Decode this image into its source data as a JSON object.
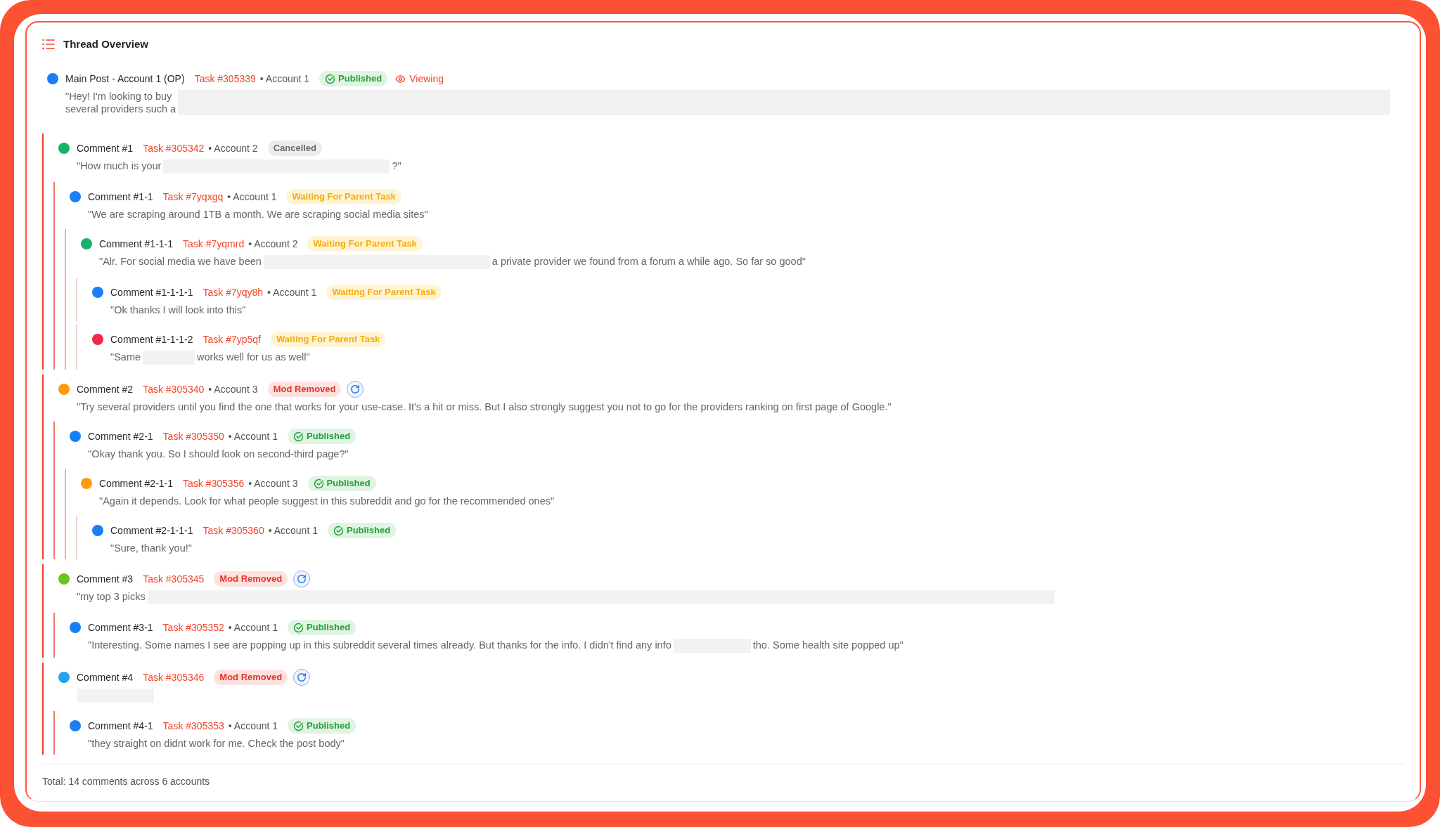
{
  "panel": {
    "title": "Thread Overview"
  },
  "post": {
    "title": "Main Post - Account 1 (OP)",
    "color": "#1a7ff5",
    "task": "Task #305339",
    "account": "• Account 1",
    "status": {
      "kind": "published",
      "label": "Published"
    },
    "refresh": false,
    "viewing": "Viewing",
    "body": [
      {
        "kind": "lines",
        "lines": [
          "\"Hey! I'm looking to buy",
          "several providers such a"
        ]
      },
      {
        "kind": "redacted-fill"
      }
    ]
  },
  "comments": [
    {
      "title": "Comment #1",
      "color": "#17b26a",
      "task": "Task #305342",
      "account": "• Account 2",
      "status": {
        "kind": "cancelled",
        "label": "Cancelled"
      },
      "refresh": false,
      "body": [
        {
          "kind": "text",
          "text": "\"How much is your"
        },
        {
          "kind": "redacted-medium"
        },
        {
          "kind": "text",
          "text": "?\""
        }
      ],
      "children": [
        {
          "title": "Comment #1-1",
          "color": "#1a7ff5",
          "task": "Task #7yqxgq",
          "account": "• Account 1",
          "status": {
            "kind": "waiting",
            "label": "Waiting For Parent Task"
          },
          "refresh": false,
          "body": [
            {
              "kind": "text",
              "text": "\"We are scraping around 1TB a month. We are scraping social media sites\""
            }
          ],
          "children": [
            {
              "title": "Comment #1-1-1",
              "color": "#17b26a",
              "task": "Task #7yqmrd",
              "account": "• Account 2",
              "status": {
                "kind": "waiting",
                "label": "Waiting For Parent Task"
              },
              "refresh": false,
              "body": [
                {
                  "kind": "text",
                  "text": "\"Alr. For social media we have been"
                },
                {
                  "kind": "redacted-medium"
                },
                {
                  "kind": "text",
                  "text": "a private provider we found from a forum a while ago. So far so good\""
                }
              ],
              "children": [
                {
                  "title": "Comment #1-1-1-1",
                  "color": "#1a7ff5",
                  "task": "Task #7yqy8h",
                  "account": "• Account 1",
                  "status": {
                    "kind": "waiting",
                    "label": "Waiting For Parent Task"
                  },
                  "refresh": false,
                  "body": [
                    {
                      "kind": "text",
                      "text": "\"Ok thanks I will look into this\""
                    }
                  ]
                },
                {
                  "title": "Comment #1-1-1-2",
                  "color": "#f0284a",
                  "task": "Task #7yp5qf",
                  "status": {
                    "kind": "waiting",
                    "label": "Waiting For Parent Task"
                  },
                  "refresh": false,
                  "body": [
                    {
                      "kind": "text",
                      "text": "\"Same"
                    },
                    {
                      "kind": "redacted-tiny"
                    },
                    {
                      "kind": "text",
                      "text": "works well for us as well\""
                    }
                  ]
                }
              ]
            }
          ]
        }
      ]
    },
    {
      "title": "Comment #2",
      "color": "#ff9a0d",
      "task": "Task #305340",
      "account": "• Account 3",
      "status": {
        "kind": "removed",
        "label": "Mod Removed"
      },
      "refresh": true,
      "body": [
        {
          "kind": "text",
          "text": "\"Try several providers until you find the one that works for your use-case. It's a hit or miss. But I also strongly suggest you not to go for the providers ranking on first page of Google.\""
        }
      ],
      "children": [
        {
          "title": "Comment #2-1",
          "color": "#1a7ff5",
          "task": "Task #305350",
          "account": "• Account 1",
          "status": {
            "kind": "published",
            "label": "Published"
          },
          "refresh": false,
          "body": [
            {
              "kind": "text",
              "text": "\"Okay thank you. So I should look on second-third page?\""
            }
          ],
          "children": [
            {
              "title": "Comment #2-1-1",
              "color": "#ff9a0d",
              "task": "Task #305356",
              "account": "• Account 3",
              "status": {
                "kind": "published",
                "label": "Published"
              },
              "refresh": false,
              "body": [
                {
                  "kind": "text",
                  "text": "\"Again it depends. Look for what people suggest in this subreddit and go for the recommended ones\""
                }
              ],
              "children": [
                {
                  "title": "Comment #2-1-1-1",
                  "color": "#1a7ff5",
                  "task": "Task #305360",
                  "account": "• Account 1",
                  "status": {
                    "kind": "published",
                    "label": "Published"
                  },
                  "refresh": false,
                  "body": [
                    {
                      "kind": "text",
                      "text": "\"Sure, thank you!\""
                    }
                  ]
                }
              ]
            }
          ]
        }
      ]
    },
    {
      "title": "Comment #3",
      "color": "#6cc51e",
      "task": "Task #305345",
      "status": {
        "kind": "removed",
        "label": "Mod Removed"
      },
      "refresh": true,
      "body": [
        {
          "kind": "text",
          "text": "\"my top 3 picks"
        },
        {
          "kind": "redacted-long"
        }
      ],
      "children": [
        {
          "title": "Comment #3-1",
          "color": "#1a7ff5",
          "task": "Task #305352",
          "account": "• Account 1",
          "status": {
            "kind": "published",
            "label": "Published"
          },
          "refresh": false,
          "body": [
            {
              "kind": "text",
              "text": "\"Interesting. Some names I see are popping up in this subreddit several times already. But thanks for the info. I didn't find any info"
            },
            {
              "kind": "redacted-short"
            },
            {
              "kind": "text",
              "text": "tho. Some health site popped up\""
            }
          ]
        }
      ]
    },
    {
      "title": "Comment #4",
      "color": "#21a3f0",
      "task": "Task #305346",
      "status": {
        "kind": "removed",
        "label": "Mod Removed"
      },
      "refresh": true,
      "body": [
        {
          "kind": "redacted-short"
        }
      ],
      "children": [
        {
          "title": "Comment #4-1",
          "color": "#1a7ff5",
          "task": "Task #305353",
          "account": "• Account 1",
          "status": {
            "kind": "published",
            "label": "Published"
          },
          "refresh": false,
          "body": [
            {
              "kind": "text",
              "text": "\"they straight on didnt work for me. Check the post body\""
            }
          ]
        }
      ]
    }
  ],
  "footer": {
    "summary": "Total: 14 comments across 6 accounts"
  }
}
